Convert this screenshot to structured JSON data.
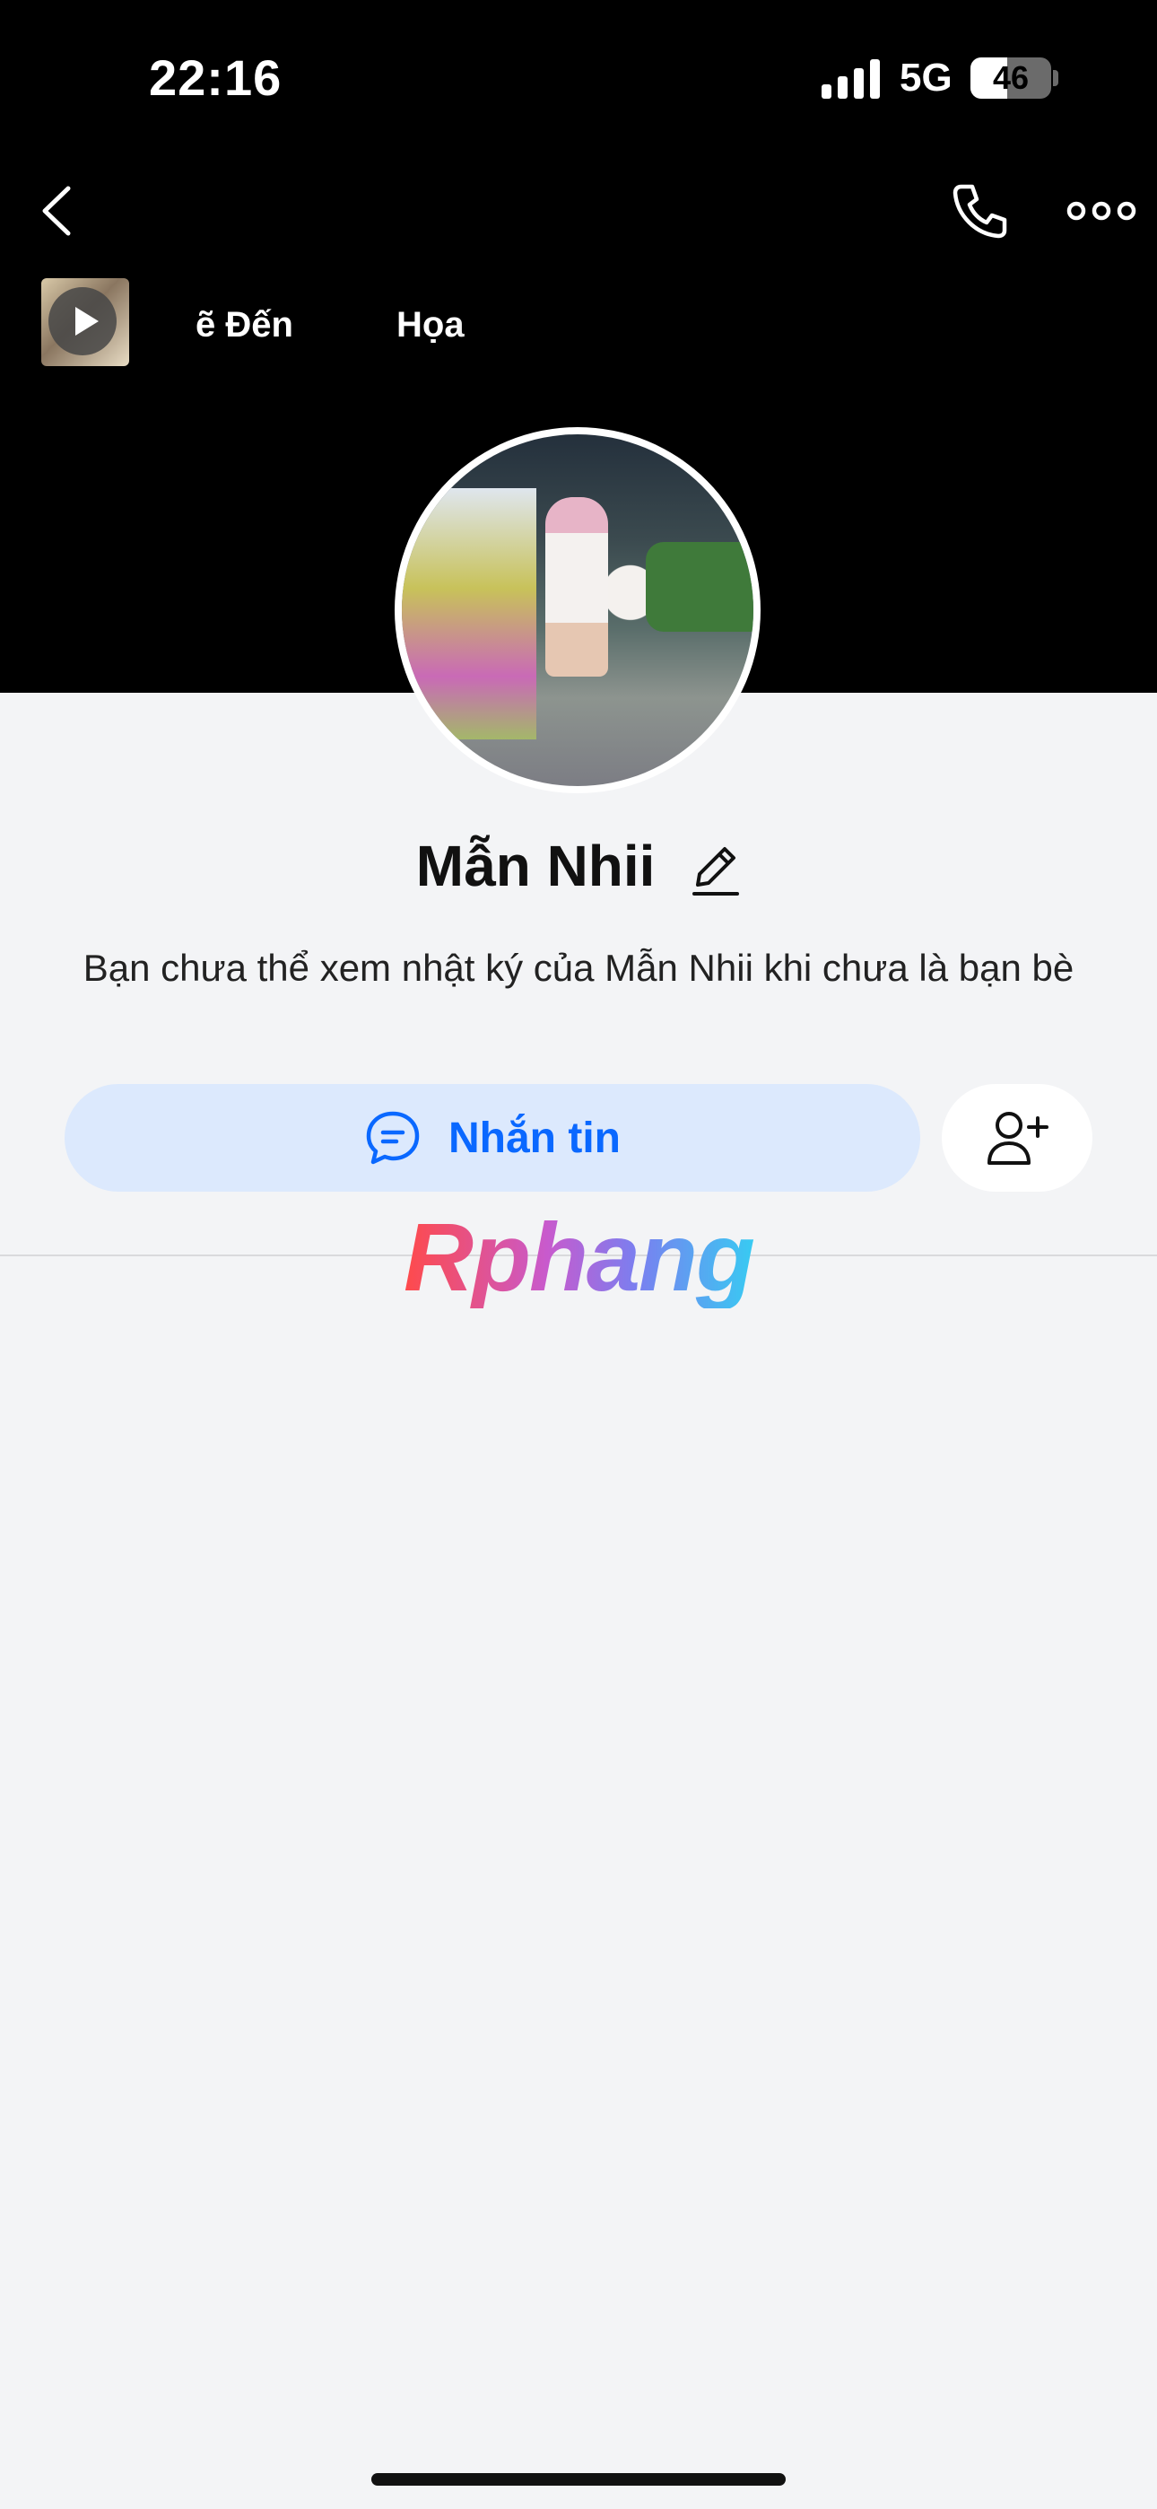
{
  "status_bar": {
    "time": "22:16",
    "network": "5G",
    "battery": "46",
    "battery_level_percent": 46
  },
  "header": {
    "icons": [
      "back-icon",
      "phone-icon",
      "more-icon"
    ]
  },
  "music": {
    "track_text_1": "ẽ Đến",
    "track_text_2": "Họa",
    "thumb_icon": "play-icon"
  },
  "profile": {
    "name": "Mẫn Nhii",
    "edit_icon": "pencil-icon",
    "notice": "Bạn chưa thể xem nhật ký của Mẫn Nhii khi chưa là bạn bè"
  },
  "actions": {
    "message_label": "Nhắn tin",
    "message_icon": "chat-bubble-icon",
    "add_friend_icon": "add-user-icon"
  },
  "watermark": {
    "text": "Rphang"
  },
  "colors": {
    "accent": "#0a68ff",
    "message_button_bg": "#dce9fd",
    "cover_bg": "#000000",
    "page_bg": "#f3f4f6"
  }
}
